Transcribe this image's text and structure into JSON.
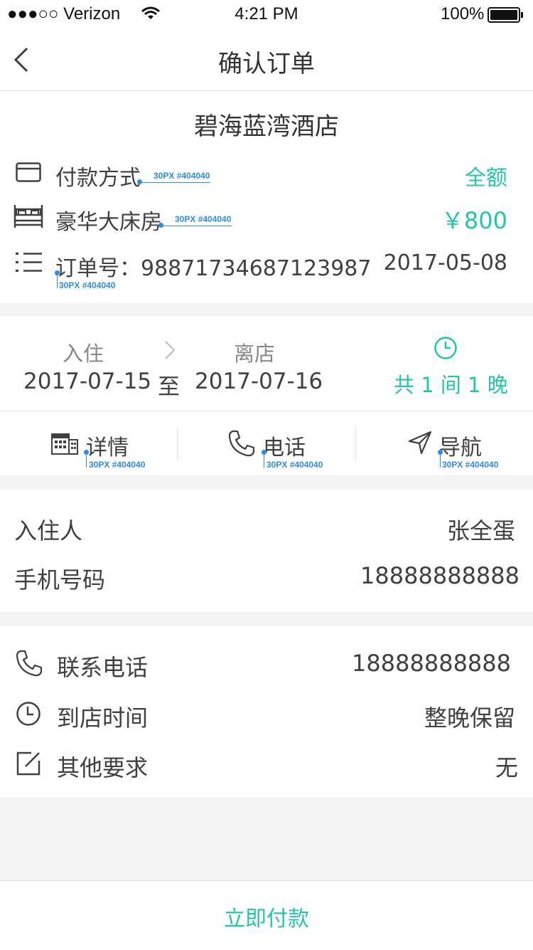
{
  "status_bar": {
    "carrier": "●●●○○ Verizon",
    "time": "4:21 PM",
    "battery": "100%"
  },
  "nav": {
    "title": "确认订单",
    "back_icon": "chevron-left-icon"
  },
  "hotel": {
    "name": "碧海蓝湾酒店",
    "payment_label": "付款方式",
    "payment_value": "全额",
    "room_label": "豪华大床房",
    "room_price": "￥800",
    "order_label": "订单号：98871734687123987",
    "order_date": "2017-05-08"
  },
  "stay": {
    "checkin_label": "入住",
    "checkout_label": "离店",
    "checkin_date": "2017-07-15",
    "to": "至",
    "checkout_date": "2017-07-16",
    "summary": "共 1 间 1 晚"
  },
  "actions": {
    "detail": "详情",
    "phone": "电话",
    "navigate": "导航"
  },
  "guest": {
    "name_label": "入住人",
    "name_value": "张全蛋",
    "mobile_label": "手机号码",
    "mobile_value": "18888888888"
  },
  "contact": {
    "phone_label": "联系电话",
    "phone_value": "18888888888",
    "arrival_label": "到店时间",
    "arrival_value": "整晚保留",
    "other_label": "其他要求",
    "other_value": "无"
  },
  "footer": {
    "pay_button": "立即付款"
  },
  "annotations": {
    "font_spec": "30PX #404040"
  },
  "colors": {
    "accent": "#25c6a8",
    "text": "#404040",
    "annotation": "#2f8ce6"
  }
}
